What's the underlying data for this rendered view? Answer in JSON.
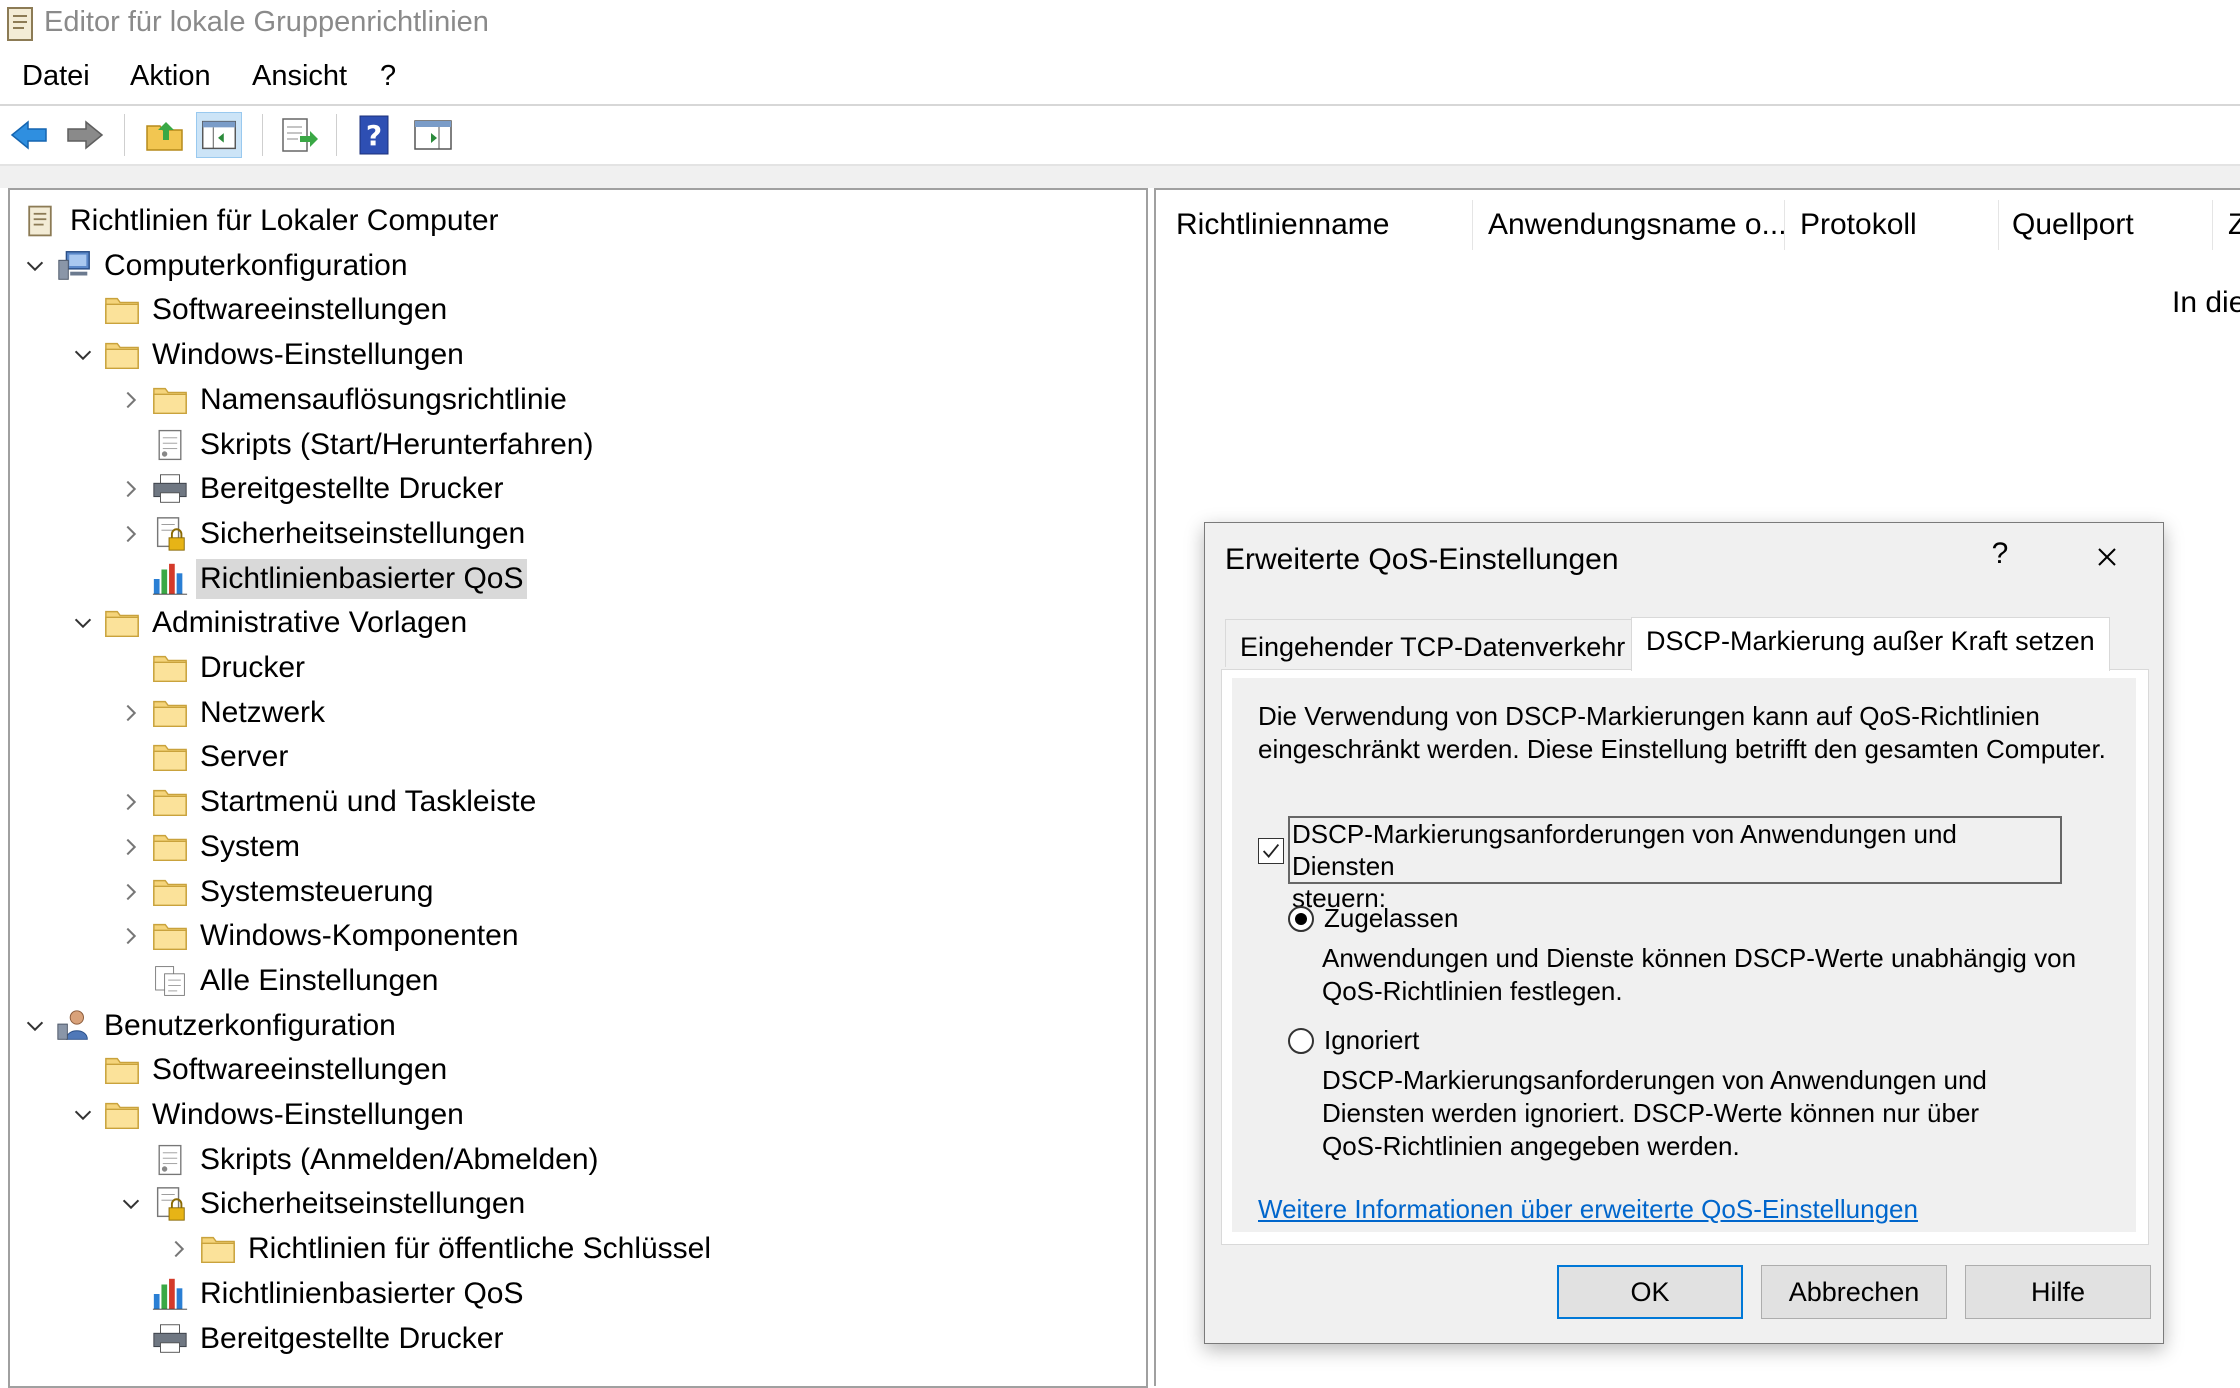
{
  "window": {
    "title": "Editor für lokale Gruppenrichtlinien"
  },
  "menu": {
    "items": [
      "Datei",
      "Aktion",
      "Ansicht",
      "?"
    ]
  },
  "toolbar": {
    "icons": [
      "back-icon",
      "forward-icon",
      "up-folder-icon",
      "show-hide-tree-icon",
      "export-list-icon",
      "help-icon",
      "show-action-pane-icon"
    ],
    "selected": "show-hide-tree-icon"
  },
  "tree": {
    "root": "Richtlinien für Lokaler Computer",
    "nodes": [
      {
        "label": "Computerkonfiguration",
        "icon": "computer-icon",
        "expanded": true
      },
      {
        "label": "Softwareeinstellungen",
        "icon": "folder-icon"
      },
      {
        "label": "Windows-Einstellungen",
        "icon": "folder-icon",
        "expanded": true
      },
      {
        "label": "Namensauflösungsrichtlinie",
        "icon": "folder-icon",
        "expandable": true
      },
      {
        "label": "Skripts (Start/Herunterfahren)",
        "icon": "script-icon"
      },
      {
        "label": "Bereitgestellte Drucker",
        "icon": "printer-icon",
        "expandable": true
      },
      {
        "label": "Sicherheitseinstellungen",
        "icon": "security-icon",
        "expandable": true
      },
      {
        "label": "Richtlinienbasierter QoS",
        "icon": "qos-chart-icon",
        "selected": true
      },
      {
        "label": "Administrative Vorlagen",
        "icon": "folder-icon",
        "expanded": true
      },
      {
        "label": "Drucker",
        "icon": "folder-icon"
      },
      {
        "label": "Netzwerk",
        "icon": "folder-icon",
        "expandable": true
      },
      {
        "label": "Server",
        "icon": "folder-icon"
      },
      {
        "label": "Startmenü und Taskleiste",
        "icon": "folder-icon",
        "expandable": true
      },
      {
        "label": "System",
        "icon": "folder-icon",
        "expandable": true
      },
      {
        "label": "Systemsteuerung",
        "icon": "folder-icon",
        "expandable": true
      },
      {
        "label": "Windows-Komponenten",
        "icon": "folder-icon",
        "expandable": true
      },
      {
        "label": "Alle Einstellungen",
        "icon": "all-settings-icon"
      },
      {
        "label": "Benutzerkonfiguration",
        "icon": "user-config-icon",
        "expanded": true
      },
      {
        "label": "Softwareeinstellungen",
        "icon": "folder-icon"
      },
      {
        "label": "Windows-Einstellungen",
        "icon": "folder-icon",
        "expanded": true
      },
      {
        "label": "Skripts (Anmelden/Abmelden)",
        "icon": "script-icon"
      },
      {
        "label": "Sicherheitseinstellungen",
        "icon": "security-icon",
        "expanded": true
      },
      {
        "label": "Richtlinien für öffentliche Schlüssel",
        "icon": "folder-icon",
        "expandable": true
      },
      {
        "label": "Richtlinienbasierter QoS",
        "icon": "qos-chart-icon"
      },
      {
        "label": "Bereitgestellte Drucker",
        "icon": "printer-icon"
      }
    ]
  },
  "details": {
    "columns": [
      "Richtlinienname",
      "Anwendungsname o...",
      "Protokoll",
      "Quellport",
      "Z"
    ],
    "empty_message": "In die"
  },
  "dialog": {
    "title": "Erweiterte QoS-Einstellungen",
    "help_label": "?",
    "tabs": [
      "Eingehender TCP-Datenverkehr",
      "DSCP-Markierung außer Kraft setzen"
    ],
    "active_tab": "DSCP-Markierung außer Kraft setzen",
    "description_line1": "Die Verwendung von DSCP-Markierungen kann auf QoS-Richtlinien",
    "description_line2": "eingeschränkt werden. Diese Einstellung betrifft den gesamten Computer.",
    "checkbox": {
      "label_line1": "DSCP-Markierungsanforderungen von Anwendungen und Diensten",
      "label_line2": "steuern:",
      "checked": true
    },
    "option_allow": {
      "label": "Zugelassen",
      "selected": true,
      "desc_line1": "Anwendungen und Dienste können DSCP-Werte unabhängig von",
      "desc_line2": "QoS-Richtlinien festlegen."
    },
    "option_ignore": {
      "label": "Ignoriert",
      "selected": false,
      "desc_line1": "DSCP-Markierungsanforderungen von Anwendungen und",
      "desc_line2": "Diensten werden ignoriert. DSCP-Werte können nur über",
      "desc_line3": "QoS-Richtlinien angegeben werden."
    },
    "link": "Weitere Informationen über erweiterte QoS-Einstellungen",
    "buttons": {
      "ok": "OK",
      "cancel": "Abbrechen",
      "help": "Hilfe"
    }
  },
  "colors": {
    "accent": "#0078d7",
    "link": "#0066cc",
    "selection": "#d9d9d9",
    "dialog_bg": "#f0f0f0"
  }
}
